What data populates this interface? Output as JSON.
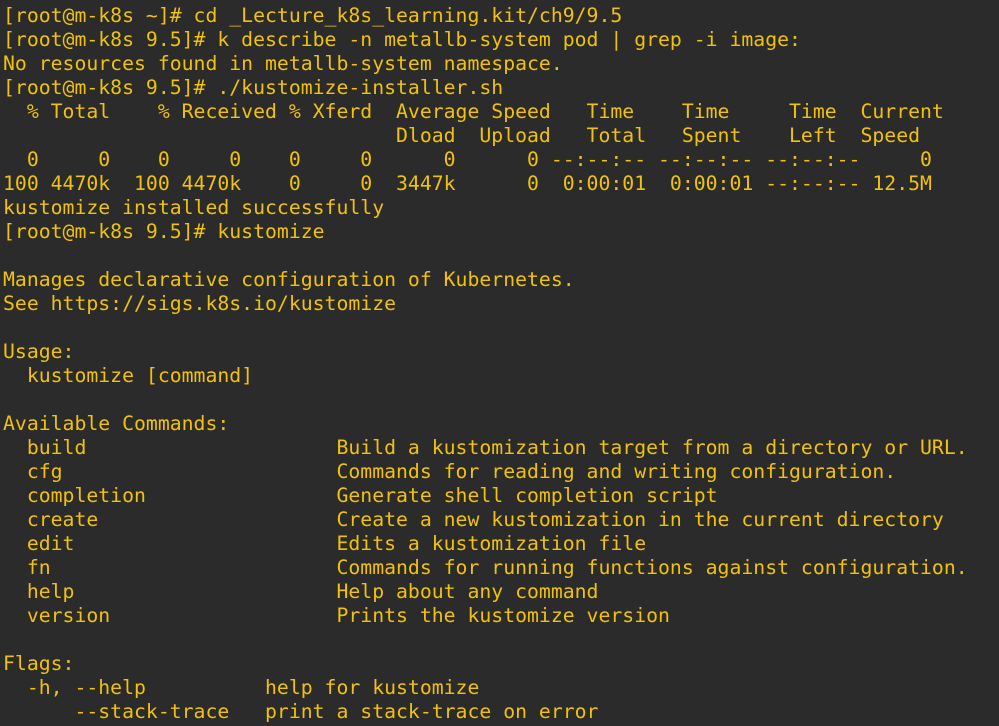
{
  "terminal": {
    "text_color": "#f0c20e",
    "background": "#2b2b2b",
    "lines": [
      "[root@m-k8s ~]# cd _Lecture_k8s_learning.kit/ch9/9.5",
      "[root@m-k8s 9.5]# k describe -n metallb-system pod | grep -i image:",
      "No resources found in metallb-system namespace.",
      "[root@m-k8s 9.5]# ./kustomize-installer.sh",
      "  % Total    % Received % Xferd  Average Speed   Time    Time     Time  Current",
      "                                 Dload  Upload   Total   Spent    Left  Speed",
      "  0     0    0     0    0     0      0      0 --:--:-- --:--:-- --:--:--     0",
      "100 4470k  100 4470k    0     0  3447k      0  0:00:01  0:00:01 --:--:-- 12.5M",
      "kustomize installed successfully",
      "[root@m-k8s 9.5]# kustomize",
      "",
      "Manages declarative configuration of Kubernetes.",
      "See https://sigs.k8s.io/kustomize",
      "",
      "Usage:",
      "  kustomize [command]",
      "",
      "Available Commands:",
      "  build                     Build a kustomization target from a directory or URL.",
      "  cfg                       Commands for reading and writing configuration.",
      "  completion                Generate shell completion script",
      "  create                    Create a new kustomization in the current directory",
      "  edit                      Edits a kustomization file",
      "  fn                        Commands for running functions against configuration.",
      "  help                      Help about any command",
      "  version                   Prints the kustomize version",
      "",
      "Flags:",
      "  -h, --help          help for kustomize",
      "      --stack-trace   print a stack-trace on error"
    ]
  }
}
